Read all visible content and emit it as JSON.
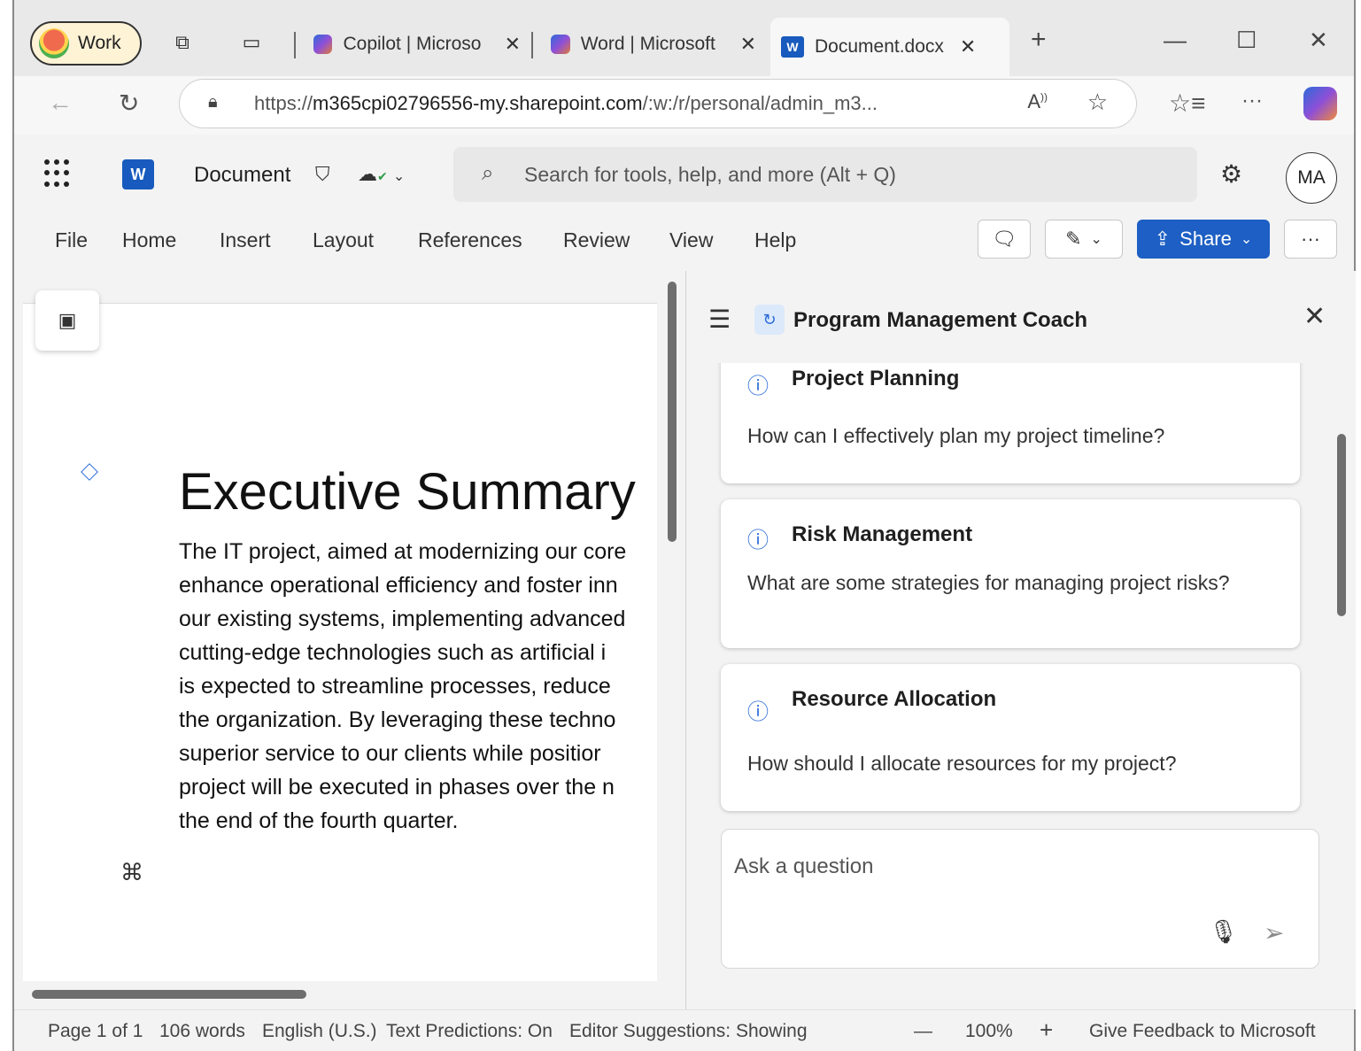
{
  "browser": {
    "profile_label": "Work",
    "tabs": [
      {
        "label": "Copilot | Microso",
        "close": "✕"
      },
      {
        "label": "Word | Microsoft",
        "close": "✕"
      },
      {
        "label": "Document.docx",
        "close": "✕"
      }
    ],
    "new_tab": "+",
    "url_prefix": "https://",
    "url_host": "m365cpi02796556-my.sharepoint.com",
    "url_path": "/:w:/r/personal/admin_m3...",
    "read_aloud": "A⁹"
  },
  "word": {
    "doc_title": "Document",
    "search_placeholder": "Search for tools, help, and more (Alt + Q)",
    "avatar_initials": "MA",
    "ribbon_tabs": [
      "File",
      "Home",
      "Insert",
      "Layout",
      "References",
      "Review",
      "View",
      "Help"
    ],
    "share_label": "Share",
    "more_label": "···"
  },
  "document": {
    "heading": "Executive Summary",
    "lines": [
      "The IT project, aimed at modernizing our core",
      "enhance operational efficiency and foster inn",
      "our existing systems, implementing advanced",
      "cutting-edge technologies such as artificial i",
      "is expected to streamline processes, reduce",
      "the organization. By leveraging these techno",
      "superior service to our clients while positior",
      "project will be executed in phases over the n",
      "the end of the fourth quarter."
    ]
  },
  "copilot_pane": {
    "title": "Program Management Coach",
    "cards": [
      {
        "title": "Project Planning",
        "text": "How can I effectively plan my project timeline?"
      },
      {
        "title": "Risk Management",
        "text": "What are some strategies for managing project risks?"
      },
      {
        "title": "Resource Allocation",
        "text": "How should I allocate resources for my project?"
      }
    ],
    "ask_placeholder": "Ask a question"
  },
  "status": {
    "page": "Page 1 of 1",
    "words": "106 words",
    "language": "English (U.S.)",
    "predictions": "Text Predictions: On",
    "editor": "Editor Suggestions: Showing",
    "zoom_out": "—",
    "zoom": "100%",
    "zoom_in": "+",
    "feedback": "Give Feedback to Microsoft"
  },
  "colors": {
    "accent": "#1d5fc4",
    "word_brand": "#185abd"
  }
}
